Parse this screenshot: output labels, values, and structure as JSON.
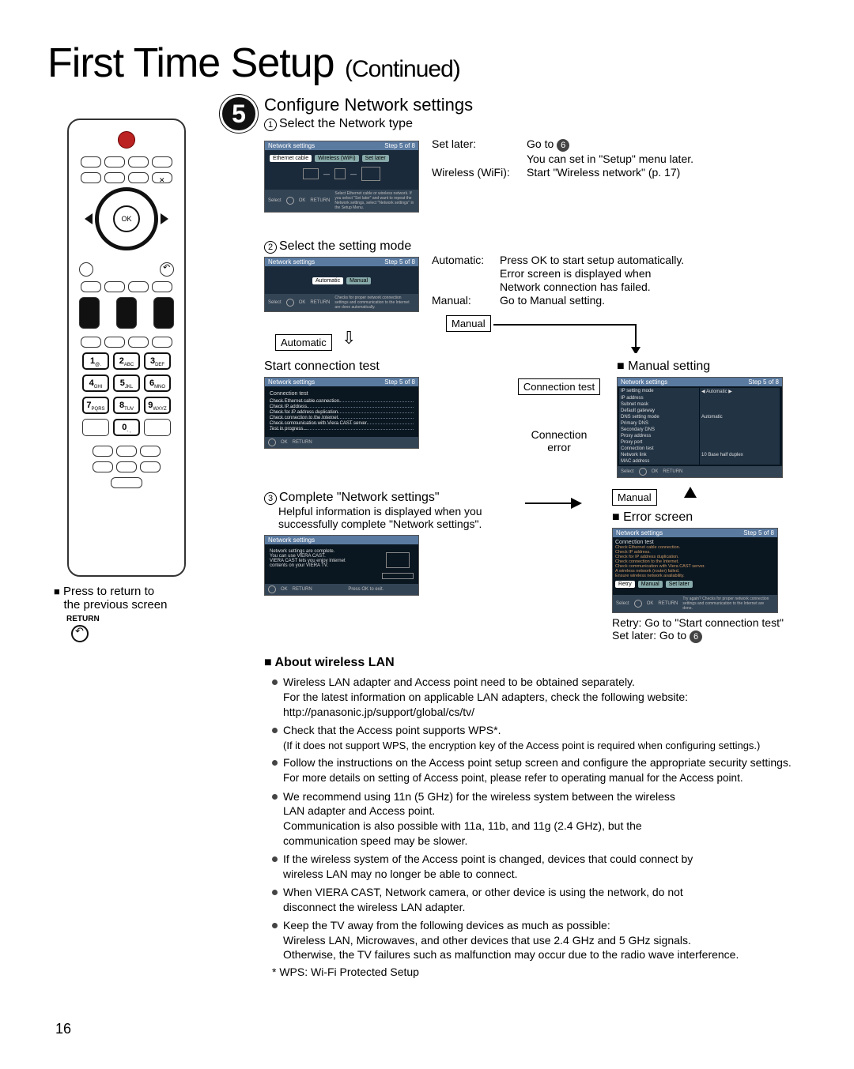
{
  "page": {
    "title": "First Time Setup",
    "title_suffix": "(Continued)",
    "number": "16"
  },
  "remote": {
    "ok": "OK",
    "keys": {
      "k1": "1",
      "s1": "@.",
      "k2": "2",
      "s2": "ABC",
      "k3": "3",
      "s3": "DEF",
      "k4": "4",
      "s4": "GHI",
      "k5": "5",
      "s5": "JKL",
      "k6": "6",
      "s6": "MNO",
      "k7": "7",
      "s7": "PQRS",
      "k8": "8",
      "s8": "TUV",
      "k9": "9",
      "s9": "WXYZ",
      "k0": "0",
      "s0": "- ,"
    },
    "return_note_line1": "Press to return to",
    "return_note_line2": "the previous screen",
    "return_label": "RETURN"
  },
  "step": {
    "badge": "5",
    "title": "Configure Network settings",
    "sub1": {
      "num": "1",
      "label": "Select the Network type"
    },
    "sub2": {
      "num": "2",
      "label": "Select the setting mode"
    },
    "sub3": {
      "num": "3",
      "label": "Complete \"Network settings\""
    },
    "sub3_desc_l1": "Helpful information is displayed when you",
    "sub3_desc_l2": "successfully complete \"Network settings\"."
  },
  "panels": {
    "p1": {
      "hdr": "Network settings",
      "stepn": "Step 5 of 8",
      "tabs": [
        "Ethernet cable",
        "Wireless (WiFi)",
        "Set later"
      ],
      "foot1": "Select",
      "foot2": "OK",
      "foot3": "RETURN",
      "foot_note": "Select Ethernet cable or wireless network. If you select \"Set later\" and want to repeat the Network settings, select \"Network settings\" in the Setup Menu."
    },
    "p2": {
      "hdr": "Network settings",
      "stepn": "Step 5 of 8",
      "tabs": [
        "Automatic",
        "Manual"
      ],
      "foot1": "Select",
      "foot2": "OK",
      "foot3": "RETURN",
      "foot_note": "Checks for proper network connection settings and communication to the Internet are done automatically."
    },
    "p3": {
      "hdr": "Network settings",
      "stepn": "Step 5 of 8",
      "sub": "Connection test",
      "lines": [
        "Check Ethernet cable connection.",
        "Check IP address.",
        "Check for IP address duplication.",
        "Check connection to the Internet.",
        "Check communication with Viera CAST server.",
        "Test in progress..."
      ],
      "foot2": "OK",
      "foot3": "RETURN"
    },
    "p4": {
      "hdr": "Network settings",
      "stepn": "Step 5 of 8",
      "rows": [
        "IP setting mode",
        "IP address",
        "Subnet mask",
        "Default gateway",
        "DNS setting mode",
        "Primary DNS",
        "Secondary DNS",
        "Proxy address",
        "Proxy port",
        "Connection test",
        "Network link",
        "MAC address"
      ],
      "vals": [
        "Automatic",
        "",
        "",
        "",
        "Automatic",
        "",
        "",
        "",
        "",
        "",
        "10 Base half duplex",
        ""
      ],
      "foot1": "Select",
      "foot2": "OK",
      "foot3": "RETURN"
    },
    "p5": {
      "hdr": "Network settings",
      "stepn": "",
      "msg_l1": "Network settings are complete.",
      "msg_l2": "You can use VIERA CAST.",
      "msg_l3": "VIERA CAST lets you enjoy Internet",
      "msg_l4": "contents on your VIERA TV.",
      "foot2": "OK",
      "foot3": "RETURN",
      "foot_note": "Press OK to exit."
    },
    "p6": {
      "hdr": "Network settings",
      "stepn": "Step 5 of 8",
      "sub": "Connection test",
      "lines": [
        "Check Ethernet cable connection.",
        "Check IP address.",
        "Check for IP address duplication.",
        "Check connection to the Internet.",
        "Check communication with Viera CAST server.",
        "A wireless network (router) failed.",
        "Ensure wireless network availability."
      ],
      "tabs": [
        "Retry",
        "Manual",
        "Set later"
      ],
      "foot1": "Select",
      "foot2": "OK",
      "foot3": "RETURN",
      "foot_note": "Try again? Checks for proper network connection settings and communication to the Internet are done."
    }
  },
  "notes1": {
    "set_later_k": "Set later:",
    "set_later_v": "Go to ",
    "set_later_ref": "6",
    "set_later_l2": "You can set in \"Setup\" menu later.",
    "wifi_k": "Wireless (WiFi):",
    "wifi_v": "Start \"Wireless network\" (p. 17)"
  },
  "notes2": {
    "auto_k": "Automatic:",
    "auto_l1": "Press OK to start setup automatically.",
    "auto_l2": "Error screen is displayed when",
    "auto_l3": "Network connection has failed.",
    "man_k": "Manual:",
    "man_v": "Go to Manual setting."
  },
  "flow": {
    "automatic": "Automatic",
    "manual": "Manual",
    "start_conn": "Start connection test",
    "man_set": "Manual setting",
    "conn_test": "Connection test",
    "conn_err_l1": "Connection",
    "conn_err_l2": "error",
    "error_screen": "Error screen",
    "retry_l": "Retry: Go to \"Start connection test\"",
    "setlater_l": "Set later: Go to ",
    "setlater_ref": "6"
  },
  "wlan": {
    "heading": "About wireless LAN",
    "b1_l1": "Wireless LAN adapter and Access point need to be obtained separately.",
    "b1_l2": "For the latest information on applicable LAN adapters, check the following website:",
    "b1_l3": "http://panasonic.jp/support/global/cs/tv/",
    "b2_l1": "Check that the Access point supports WPS*.",
    "b2_l2": "(If it does not support WPS, the encryption key of the Access point is required when configuring settings.)",
    "b3_l1": "Follow the instructions on the Access point setup screen and configure the appropriate security settings.",
    "b3_l2": "For more details on setting of Access point, please refer to operating manual for the Access point.",
    "b4_l1": "We recommend using 11n (5 GHz) for the wireless system between the wireless",
    "b4_l2": "LAN adapter and Access point.",
    "b4_l3": "Communication is also possible with 11a, 11b, and 11g (2.4 GHz), but the",
    "b4_l4": "communication speed may be slower.",
    "b5_l1": "If the wireless system of the Access point is changed, devices that could connect by",
    "b5_l2": "wireless LAN may no longer be able to connect.",
    "b6_l1": "When VIERA CAST, Network camera, or other device is using the network, do not",
    "b6_l2": "disconnect the wireless LAN adapter.",
    "b7_l1": "Keep the TV away from the following devices as much as possible:",
    "b7_l2": "Wireless LAN, Microwaves, and other devices that use 2.4 GHz and 5 GHz signals.",
    "b7_l3": "Otherwise, the TV failures such as malfunction may occur due to the radio wave interference.",
    "footnote": "* WPS: Wi-Fi Protected Setup"
  }
}
